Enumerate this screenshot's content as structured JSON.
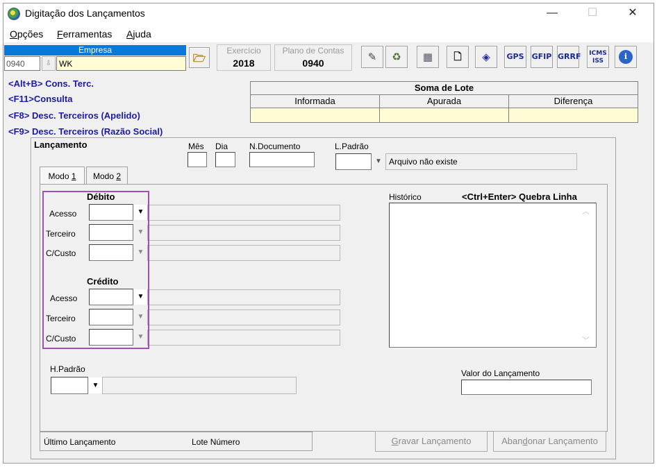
{
  "window": {
    "title": "Digitação dos Lançamentos",
    "minimize": "—",
    "maximize": "☐",
    "close": "✕"
  },
  "menu": [
    {
      "label_u": "O",
      "label_rest": "pções"
    },
    {
      "label_u": "F",
      "label_rest": "erramentas"
    },
    {
      "label_u": "A",
      "label_rest": "juda"
    }
  ],
  "empresa": {
    "header": "Empresa",
    "code": "0940",
    "name": "WK"
  },
  "exercicio": {
    "label": "Exercício",
    "value": "2018"
  },
  "plano": {
    "label": "Plano de Contas",
    "value": "0940"
  },
  "toolbar": {
    "gps": "GPS",
    "gfip": "GFIP",
    "grrf": "GRRF",
    "icms_1": "ICMS",
    "icms_2": "ISS",
    "info": "i"
  },
  "hotkeys": [
    "<Alt+B> Cons. Terc.",
    "<F11>Consulta",
    "<F8> Desc. Terceiros (Apelido)",
    "<F9> Desc. Terceiros (Razão Social)"
  ],
  "soma_lote": {
    "title": "Soma de Lote",
    "columns": [
      "Informada",
      "Apurada",
      "Diferença"
    ]
  },
  "lancamento": {
    "group_label": "Lançamento",
    "mes_label": "Mês",
    "dia_label": "Dia",
    "ndoc_label": "N.Documento",
    "lpadrao_label": "L.Padrão",
    "arquivo_msg": "Arquivo não existe"
  },
  "tabs": [
    {
      "label_pre": "Modo ",
      "label_u": "1"
    },
    {
      "label_pre": "Modo ",
      "label_u": "2"
    }
  ],
  "debito": {
    "title": "Débito",
    "rows": [
      "Acesso",
      "Terceiro",
      "C/Custo"
    ]
  },
  "credito": {
    "title": "Crédito",
    "rows": [
      "Acesso",
      "Terceiro",
      "C/Custo"
    ]
  },
  "historico": {
    "label": "Histórico",
    "hint": "<Ctrl+Enter> Quebra Linha"
  },
  "hpadrao": {
    "label": "H.Padrão"
  },
  "valor": {
    "label": "Valor do Lançamento"
  },
  "status": {
    "ultimo": "Último Lançamento",
    "lote": "Lote Número"
  },
  "buttons": {
    "gravar_u": "G",
    "gravar_rest": "ravar Lançamento",
    "abandonar_pre": "Aban",
    "abandonar_u": "d",
    "abandonar_rest": "onar Lançamento"
  },
  "colors": {
    "accent": "#0a78d7",
    "hotkey": "#1a1aa8",
    "highlight_box": "#a050b0",
    "yellow_field": "#fffcd6"
  }
}
